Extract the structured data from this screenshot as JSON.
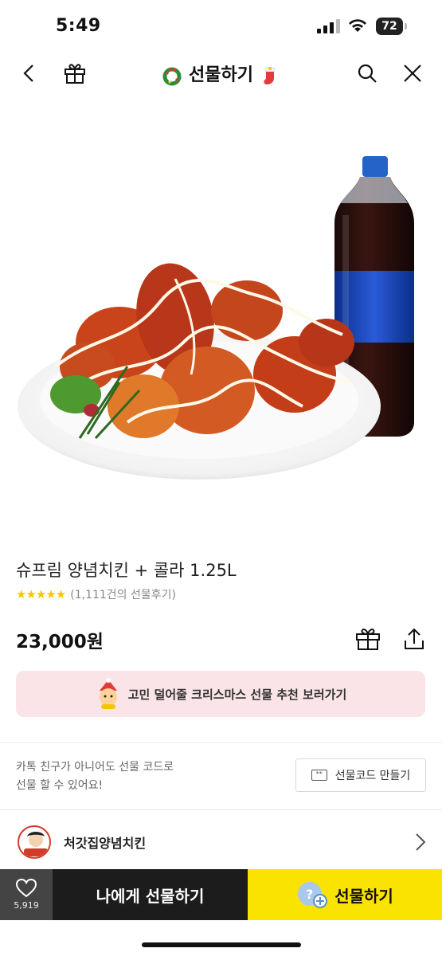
{
  "status_bar": {
    "time": "5:49",
    "battery": "72"
  },
  "nav": {
    "title": "선물하기"
  },
  "product": {
    "name": "슈프림 양념치킨 + 콜라 1.25L",
    "stars": "★★★★★",
    "review_text": "(1,111건의 선물후기)",
    "price": "23,000원"
  },
  "promo_banner": {
    "text": "고민 덜어줄 크리스마스 선물 추천 보러가기"
  },
  "gift_code": {
    "line1": "카톡 친구가 아니어도 선물 코드로",
    "line2": "선물 할 수 있어요!",
    "button_label": "선물코드 만들기"
  },
  "brand": {
    "name": "처갓집양념치킨"
  },
  "bottom_bar": {
    "wish_count": "5,919",
    "self_gift_label": "나에게 선물하기",
    "gift_label": "선물하기"
  },
  "colors": {
    "accent_yellow": "#fbe300",
    "dark_button": "#1c1c1c",
    "banner_pink": "#fbe4e8",
    "star_yellow": "#f6c700"
  }
}
